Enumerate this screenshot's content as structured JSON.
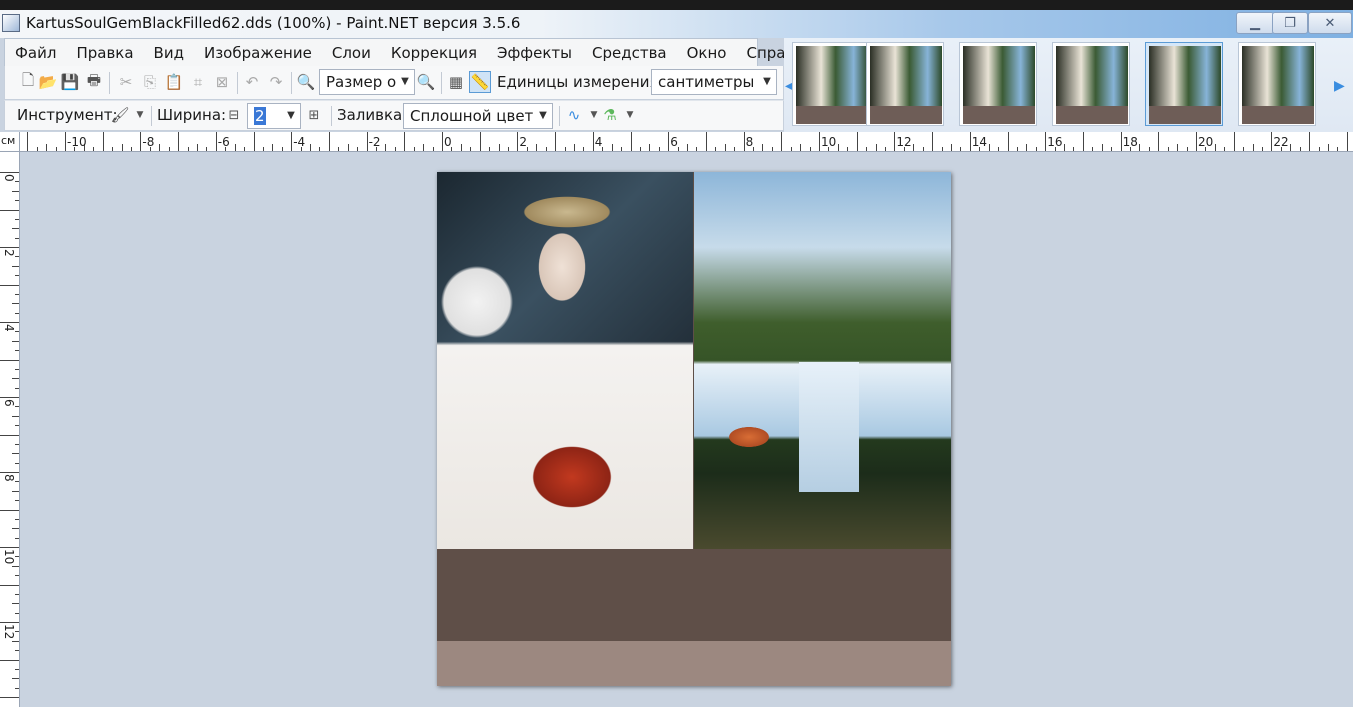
{
  "window": {
    "title": "KartusSoulGemBlackFilled62.dds (100%) - Paint.NET версия 3.5.6",
    "min_glyph": "▁",
    "max_glyph": "❐",
    "close_glyph": "✕"
  },
  "menu": [
    "Файл",
    "Правка",
    "Вид",
    "Изображение",
    "Слои",
    "Коррекция",
    "Эффекты",
    "Средства",
    "Окно",
    "Справка"
  ],
  "toolbar1": {
    "zoom_value": "Размер ок",
    "units_label": "Единицы измерения:",
    "units_value": "сантиметры"
  },
  "toolbar2": {
    "tool_label": "Инструмент:",
    "width_label": "Ширина:",
    "width_value": "2",
    "fill_label": "Заливка:",
    "fill_value": "Сплошной цвет"
  },
  "ruler": {
    "unit": "см",
    "h_labels": [
      "-10",
      "-8",
      "-6",
      "-4",
      "-2",
      "0",
      "2",
      "4",
      "6",
      "8",
      "10",
      "12",
      "14",
      "16",
      "18",
      "20",
      "22"
    ],
    "v_labels": [
      "0",
      "2",
      "4",
      "6",
      "8",
      "10",
      "12"
    ]
  },
  "colors": {
    "workspace": "#c9d3e0",
    "canvas_band_mid": "#5f4f48",
    "canvas_band_bottom": "#9c8880",
    "accent": "#3a8de0"
  },
  "thumbnails": {
    "count": 6,
    "active_index": 4
  }
}
